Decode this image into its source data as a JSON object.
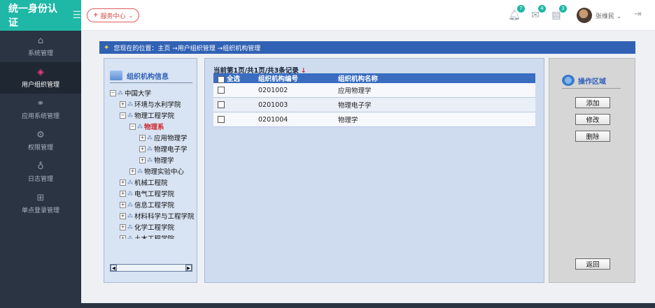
{
  "app": {
    "title": "统一身份认证",
    "menu_icon": "hamburger-icon"
  },
  "sidebar": {
    "items": [
      {
        "label": "系统管理",
        "icon": "home-icon",
        "active": false
      },
      {
        "label": "用户组织管理",
        "icon": "diamond-icon",
        "active": true
      },
      {
        "label": "应用系统管理",
        "icon": "link-icon",
        "active": false
      },
      {
        "label": "权限管理",
        "icon": "gear-icon",
        "active": false
      },
      {
        "label": "日志管理",
        "icon": "bulb-icon",
        "active": false
      },
      {
        "label": "单点登录管理",
        "icon": "briefcase-icon",
        "active": false
      }
    ]
  },
  "topbar": {
    "service_label": "服务中心",
    "notifications": [
      {
        "icon": "bell-icon",
        "count": "7"
      },
      {
        "icon": "mail-icon",
        "count": "4"
      },
      {
        "icon": "task-icon",
        "count": "3"
      }
    ],
    "user_name": "张维民",
    "logout_icon": "logout-icon"
  },
  "breadcrumb": {
    "text": "您现在的位置：主页 →用户组织管理 →组织机构管理"
  },
  "org_panel": {
    "title": "组织机构信息",
    "tree": [
      {
        "label": "中国大学",
        "depth": 0,
        "selected": false
      },
      {
        "label": "环境与水利学院",
        "depth": 1,
        "selected": false
      },
      {
        "label": "物理工程学院",
        "depth": 1,
        "selected": false
      },
      {
        "label": "物理系",
        "depth": 2,
        "selected": true
      },
      {
        "label": "应用物理学",
        "depth": 3,
        "selected": false
      },
      {
        "label": "物理电子学",
        "depth": 3,
        "selected": false
      },
      {
        "label": "物理学",
        "depth": 3,
        "selected": false
      },
      {
        "label": "物理实验中心",
        "depth": 2,
        "selected": false
      },
      {
        "label": "机械工程院",
        "depth": 1,
        "selected": false
      },
      {
        "label": "电气工程学院",
        "depth": 1,
        "selected": false
      },
      {
        "label": "信息工程学院",
        "depth": 1,
        "selected": false
      },
      {
        "label": "材料科学与工程学院",
        "depth": 1,
        "selected": false
      },
      {
        "label": "化学工程学院",
        "depth": 1,
        "selected": false
      },
      {
        "label": "土木工程学院",
        "depth": 1,
        "selected": false
      }
    ]
  },
  "list_panel": {
    "record_info": "当前第1页/共1页/共3条记录",
    "record_marker": "↓",
    "columns": {
      "select_all": "全选",
      "code": "组织机构编号",
      "name": "组织机构名称"
    },
    "rows": [
      {
        "code": "0201002",
        "name": "应用物理学"
      },
      {
        "code": "0201003",
        "name": "物理电子学"
      },
      {
        "code": "0201004",
        "name": "物理学"
      }
    ]
  },
  "ops_panel": {
    "title": "操作区域",
    "add_label": "添加",
    "edit_label": "修改",
    "delete_label": "删除",
    "back_label": "返回"
  },
  "colors": {
    "brand": "#1fb7a6",
    "sidebar": "#2a3443",
    "header_blue": "#3061b4",
    "selected_red": "#d0232a"
  }
}
